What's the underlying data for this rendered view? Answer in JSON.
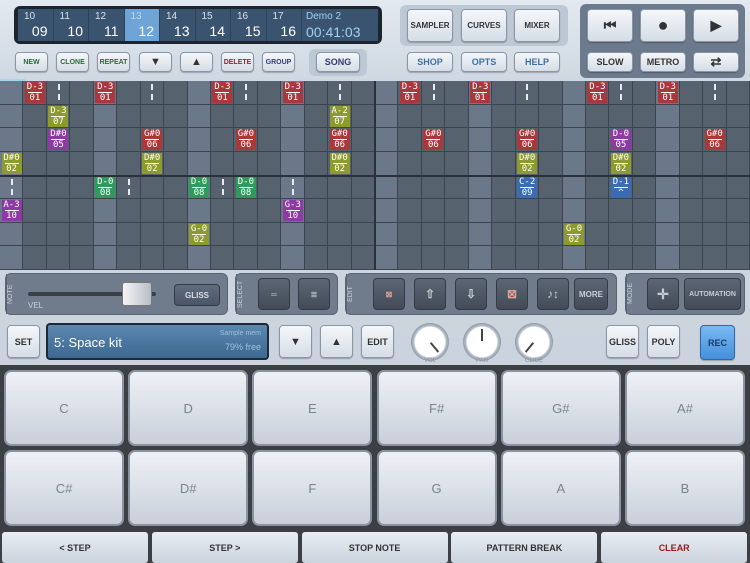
{
  "positions": [
    {
      "a": "10",
      "b": "09"
    },
    {
      "a": "11",
      "b": "10"
    },
    {
      "a": "12",
      "b": "11"
    },
    {
      "a": "13",
      "b": "12",
      "selected": true
    },
    {
      "a": "14",
      "b": "13"
    },
    {
      "a": "15",
      "b": "14"
    },
    {
      "a": "16",
      "b": "15"
    },
    {
      "a": "17",
      "b": "16"
    }
  ],
  "song": {
    "name": "Demo 2",
    "time": "00:41:03"
  },
  "pattern_buttons": {
    "new": "NEW",
    "clone": "CLONE",
    "repeat": "REPEAT",
    "down": "▼",
    "up": "▲",
    "delete": "DELETE",
    "group": "GROUP",
    "song": "SONG"
  },
  "nav": {
    "sampler": "SAMPLER",
    "curves": "CURVES",
    "mixer": "MIXER",
    "shop": "SHOP",
    "opts": "OPTS",
    "help": "HELP"
  },
  "transport": {
    "rewind": "⏮",
    "record": "●",
    "play": "▶",
    "slow": "SLOW",
    "metro": "METRO",
    "loop": "⇄"
  },
  "colors": {
    "red": "#a8383a",
    "olive": "#8c9a2e",
    "purple": "#8d3aa3",
    "green": "#2f9a5c",
    "blue": "#3b6bb0",
    "rec": "#5aa2ea"
  },
  "grid": {
    "columns": 32,
    "rows": 8,
    "notes": [
      {
        "r": 0,
        "c": 1,
        "n": "D-3",
        "i": "01",
        "k": "red"
      },
      {
        "r": 0,
        "c": 4,
        "n": "D-3",
        "i": "01",
        "k": "red"
      },
      {
        "r": 0,
        "c": 9,
        "n": "D-3",
        "i": "01",
        "k": "red"
      },
      {
        "r": 0,
        "c": 12,
        "n": "D-3",
        "i": "01",
        "k": "red"
      },
      {
        "r": 1,
        "c": 2,
        "n": "D-3",
        "i": "07",
        "k": "olive"
      },
      {
        "r": 1,
        "c": 14,
        "n": "A-2",
        "i": "07",
        "k": "olive"
      },
      {
        "r": 2,
        "c": 2,
        "n": "D#0",
        "i": "05",
        "k": "purple"
      },
      {
        "r": 2,
        "c": 6,
        "n": "G#0",
        "i": "06",
        "k": "red"
      },
      {
        "r": 2,
        "c": 10,
        "n": "G#0",
        "i": "06",
        "k": "red"
      },
      {
        "r": 2,
        "c": 14,
        "n": "G#0",
        "i": "06",
        "k": "red"
      },
      {
        "r": 3,
        "c": 0,
        "n": "D#0",
        "i": "02",
        "k": "olive"
      },
      {
        "r": 3,
        "c": 6,
        "n": "D#0",
        "i": "02",
        "k": "olive"
      },
      {
        "r": 3,
        "c": 14,
        "n": "D#0",
        "i": "02",
        "k": "olive"
      },
      {
        "r": 4,
        "c": 4,
        "n": "D-0",
        "i": "08",
        "k": "green"
      },
      {
        "r": 4,
        "c": 8,
        "n": "D-0",
        "i": "08",
        "k": "green"
      },
      {
        "r": 4,
        "c": 10,
        "n": "D-0",
        "i": "08",
        "k": "green"
      },
      {
        "r": 5,
        "c": 0,
        "n": "A-3",
        "i": "10",
        "k": "purple"
      },
      {
        "r": 5,
        "c": 12,
        "n": "G-3",
        "i": "10",
        "k": "purple"
      },
      {
        "r": 6,
        "c": 8,
        "n": "G-0",
        "i": "02",
        "k": "olive"
      },
      {
        "r": 0,
        "c": 17,
        "n": "D-3",
        "i": "01",
        "k": "red"
      },
      {
        "r": 0,
        "c": 20,
        "n": "D-3",
        "i": "01",
        "k": "red"
      },
      {
        "r": 0,
        "c": 25,
        "n": "D-3",
        "i": "01",
        "k": "red"
      },
      {
        "r": 0,
        "c": 28,
        "n": "D-3",
        "i": "01",
        "k": "red"
      },
      {
        "r": 2,
        "c": 18,
        "n": "G#0",
        "i": "06",
        "k": "red"
      },
      {
        "r": 2,
        "c": 22,
        "n": "G#0",
        "i": "06",
        "k": "red"
      },
      {
        "r": 2,
        "c": 26,
        "n": "D-0",
        "i": "05",
        "k": "purple"
      },
      {
        "r": 2,
        "c": 30,
        "n": "G#0",
        "i": "06",
        "k": "red"
      },
      {
        "r": 3,
        "c": 22,
        "n": "D#0",
        "i": "02",
        "k": "olive"
      },
      {
        "r": 3,
        "c": 26,
        "n": "D#0",
        "i": "02",
        "k": "olive"
      },
      {
        "r": 4,
        "c": 22,
        "n": "C-2",
        "i": "09",
        "k": "blue"
      },
      {
        "r": 4,
        "c": 26,
        "n": "D-1",
        "i": "^",
        "k": "blue"
      },
      {
        "r": 6,
        "c": 24,
        "n": "G-0",
        "i": "02",
        "k": "olive"
      }
    ],
    "sustains": [
      [
        0,
        2
      ],
      [
        0,
        6
      ],
      [
        0,
        10
      ],
      [
        0,
        14
      ],
      [
        4,
        0
      ],
      [
        4,
        5
      ],
      [
        4,
        9
      ],
      [
        4,
        12
      ],
      [
        0,
        18
      ],
      [
        0,
        22
      ],
      [
        0,
        26
      ],
      [
        0,
        30
      ]
    ]
  },
  "toolbar": {
    "note_label": "NOTE",
    "vel_label": "VEL",
    "gliss": "GLISS",
    "select_label": "SELECT",
    "edit_label": "EDIT",
    "more": "MORE",
    "mode_label": "MODE",
    "automation": "AUTOMATION",
    "velocity": 0.85
  },
  "instrument": {
    "set": "SET",
    "name": "5: Space kit",
    "mem_label": "Sample mem",
    "mem_free": "79% free",
    "down": "▼",
    "up": "▲",
    "edit": "EDIT",
    "gliss": "GLISS",
    "poly": "POLY",
    "rec": "REC"
  },
  "knobs": [
    {
      "label": "VOL",
      "angle": 140
    },
    {
      "label": "PAN",
      "angle": 0
    },
    {
      "label": "GLIDE",
      "angle": -140
    }
  ],
  "pads": [
    "C",
    "D",
    "E",
    "F#",
    "G#",
    "A#",
    "C#",
    "D#",
    "F",
    "G",
    "A",
    "B"
  ],
  "bottom": [
    {
      "label": "< STEP"
    },
    {
      "label": "STEP >"
    },
    {
      "label": "STOP NOTE"
    },
    {
      "label": "PATTERN BREAK"
    },
    {
      "label": "CLEAR",
      "color": "#a01818"
    }
  ]
}
